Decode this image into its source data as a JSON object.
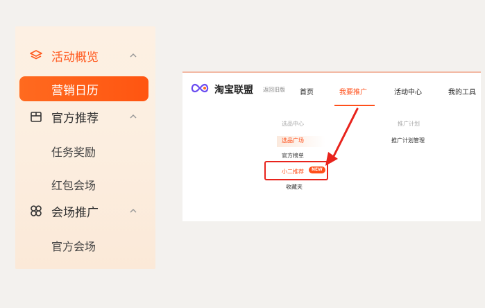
{
  "sidebar": {
    "groups": [
      {
        "label": "活动概览",
        "icon": "layers-icon",
        "expanded": true
      },
      {
        "label": "官方推荐",
        "icon": "gift-box-icon",
        "expanded": true
      },
      {
        "label": "会场推广",
        "icon": "clover-icon",
        "expanded": true
      }
    ],
    "items": {
      "active": "营销日历",
      "task_reward": "任务奖励",
      "red_packet": "红包会场",
      "official_venue": "官方会场"
    }
  },
  "panel": {
    "brand": "淘宝联盟",
    "old_version": "返回旧版",
    "nav": [
      "首页",
      "我要推广",
      "活动中心",
      "我的工具"
    ],
    "dropdown": {
      "col1_title": "选品中心",
      "col1_items": [
        "选品广场",
        "官方榜单",
        "小二推荐",
        "收藏夹"
      ],
      "col2_title": "推广计划",
      "col2_items": [
        "推广计划管理"
      ],
      "badge": "NEW"
    }
  },
  "colors": {
    "accent": "#ff5a1f",
    "annotation_red": "#e8231c"
  }
}
